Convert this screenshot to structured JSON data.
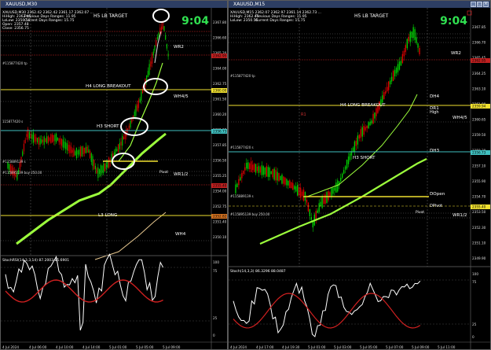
{
  "left": {
    "title": "XAUUSD,M30",
    "clock": "9:04",
    "header_line1": "XAUUSD,M30  2362.42 2362.42 2361.17 2362.07 ...",
    "info": {
      "highs": "HiHigh: 2362.45",
      "low": "LoLow: 2350.56",
      "open": "Open: 2357.48",
      "close": "Close: 2356.75",
      "prev_range": "Previous Days Ranges: 11.95",
      "curr_range": "Current Days Ranges: 15.75"
    },
    "levels": {
      "h5": "H5 LB TARGET",
      "h4": "H4 LONG BREAKOUT",
      "h3": "H3 SHORT",
      "l3": "L3 LONG",
      "wr2": "WR2",
      "wh45": "WH4/5",
      "pivot": "Pivot",
      "wr12": "WR1/2",
      "wh4": "WH4"
    },
    "side_notes": {
      "n1": "#115877420 tp",
      "n2": "115877420 s",
      "n3": "#115895139 buy 250.00",
      "n4": "#115889139 s"
    },
    "price_ticks": [
      "2367.80",
      "2366.60",
      "2365.20",
      "2364.00",
      "2362.75",
      "2361.50",
      "2360.20",
      "2359.00",
      "2357.85",
      "2356.50",
      "2355.25",
      "2354.00",
      "2352.75",
      "2351.40",
      "2350.10"
    ],
    "price_tags": [
      "2362.95",
      "2360.00",
      "2356.73",
      "2355.40",
      "2352.82"
    ],
    "osc_label": "StochRSI(14,3,3,14) 87.2003 85.6901",
    "osc_ticks": [
      "100",
      "75",
      "25",
      "0"
    ],
    "time_ticks": [
      "4 Jul 2024",
      "4 Jul 06:00",
      "4 Jul 10:00",
      "4 Jul 14:00",
      "5 Jul 01:00",
      "5 Jul 05:00",
      "5 Jul 09:00"
    ]
  },
  "right": {
    "title": "XAUUSD,M15",
    "clock": "9:04",
    "header_line1": "XAUUSD,M15  2362.07 2362.97 2361.14 2362.73 ...",
    "info": {
      "highs": "HiHigh: 2362.45",
      "low": "LoLow: 2350.56",
      "prev_range": "Previous Days Ranges: 11.95",
      "curr_range": "Current Days Ranges: 15.75"
    },
    "levels": {
      "h5": "H5 LB TARGET",
      "h4": "H4 LONG BREAKOUT",
      "h3": "H3 SHORT",
      "wr2": "WR2",
      "wh45": "WH4/5",
      "dh4": "DH4",
      "dr1": "DR1",
      "high": "High",
      "dh3": "DH3",
      "dopen": "DOpen",
      "dpivot": "DPivot",
      "pivot": "Pivot",
      "wr12": "WR1/2",
      "r1": "R1"
    },
    "side_notes": {
      "n1": "#115877420 tp",
      "n2": "#115877420 s",
      "n3": "#115895139 buy 250.00",
      "n4": "#115889139 s"
    },
    "price_ticks": [
      "2367.85",
      "2366.70",
      "2365.45",
      "2364.25",
      "2363.10",
      "2361.90",
      "2360.65",
      "2359.50",
      "2358.30",
      "2357.10",
      "2355.90",
      "2354.70",
      "2353.50",
      "2352.30",
      "2351.10",
      "2349.90"
    ],
    "price_tags": [
      "2362.95",
      "2359.94",
      "2356.73",
      "2355.40"
    ],
    "osc_label": "Stoch(14,3,3) 86.3296 88.0487",
    "osc_ticks": [
      "100",
      "75",
      "25",
      "0"
    ],
    "time_ticks": [
      "4 Jul 2024",
      "4 Jul 17:00",
      "4 Jul 19:30",
      "5 Jul 01:00",
      "5 Jul 03:00",
      "5 Jul 05:00",
      "5 Jul 07:00",
      "5 Jul 09:00",
      "5 Jul 11:00"
    ]
  },
  "colors": {
    "bull": "#00d000",
    "bear": "#e00000",
    "ma_fast": "#9cff3c",
    "ma_slow": "#e8c890",
    "level_yellow": "#f0e030",
    "level_cyan": "#40c0c0",
    "level_red": "#c02020",
    "clock": "#30e050",
    "osc_white": "#ffffff",
    "osc_red": "#d02020"
  }
}
